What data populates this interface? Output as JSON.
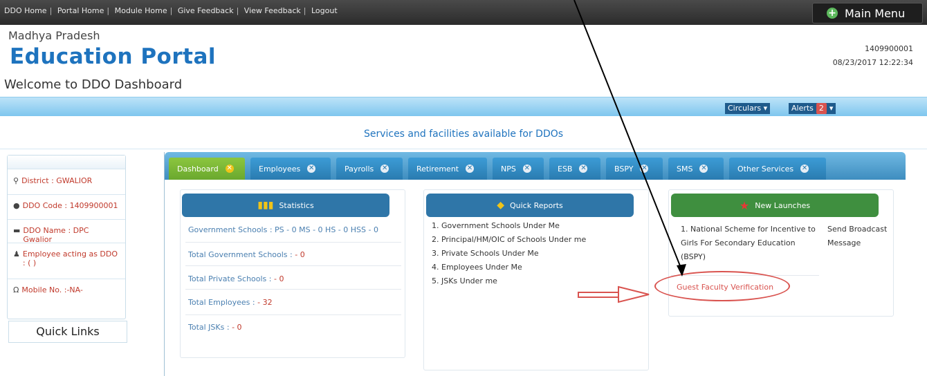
{
  "topnav": {
    "links": [
      "DDO Home",
      "Portal Home",
      "Module Home",
      "Give Feedback",
      "View Feedback",
      "Logout"
    ],
    "main_menu": "Main Menu"
  },
  "header": {
    "state": "Madhya Pradesh",
    "portal": "Education Portal",
    "welcome": "Welcome to DDO Dashboard",
    "user_code": "1409900001",
    "datetime": "08/23/2017 12:22:34"
  },
  "strip": {
    "circulars": "Circulars",
    "alerts": "Alerts",
    "alerts_count": "2"
  },
  "services_title": "Services and facilities available for DDOs",
  "profile": {
    "district": "District : GWALIOR",
    "ddo_code": "DDO Code : 1409900001",
    "ddo_name": "DDO Name : DPC Gwalior",
    "acting": "Employee acting as DDO : ( )",
    "mobile": "Mobile No. :-NA-"
  },
  "quick_links": "Quick Links",
  "tabs": [
    "Dashboard",
    "Employees",
    "Payrolls",
    "Retirement",
    "NPS",
    "ESB",
    "BSPY",
    "SMS",
    "Other Services"
  ],
  "statistics": {
    "title": "Statistics",
    "govt_schools": "Government Schools : PS - 0 MS - 0 HS - 0 HSS - 0",
    "total_govt_label": "Total Government Schools :",
    "total_govt_value": "- 0",
    "total_private_label": "Total Private Schools :",
    "total_private_value": "- 0",
    "total_employees_label": "Total Employees :",
    "total_employees_value": "- 32",
    "total_jsk_label": "Total JSKs :",
    "total_jsk_value": "- 0"
  },
  "quick_reports": {
    "title": "Quick Reports",
    "items": [
      "1. Government Schools Under Me",
      "2. Principal/HM/OIC of Schools Under me",
      "3. Private Schools Under Me",
      "4. Employees Under Me",
      "5. JSKs Under me"
    ]
  },
  "new_launches": {
    "title": "New Launches",
    "scheme": "1. National Scheme for Incentive to Girls For Secondary Education (BSPY)",
    "broadcast": "Send Broadcast Message",
    "guest": "Guest Faculty Verification"
  },
  "colors": {
    "portal_blue": "#1e73be",
    "tab_active": "#8cc63f",
    "tab_blue": "#2a7bb0",
    "red": "#d9534f"
  }
}
